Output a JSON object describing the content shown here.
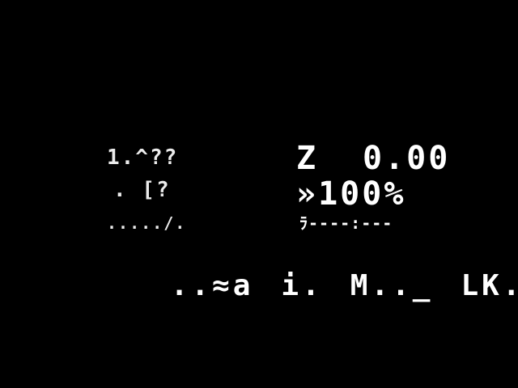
{
  "screen": {
    "background": "#000000",
    "foreground": "#ffffff"
  },
  "left_status": {
    "row1": "1.^??",
    "row2": ". [?",
    "row3": "...../."
  },
  "right_status": {
    "z_label": "Z",
    "z_value": "0.00",
    "speed": "»100%",
    "progress": "ﾗ----:---"
  },
  "bottom_menu": {
    "item1": "..≈a",
    "item2": "i.",
    "item3": "M.._",
    "item4": "LK."
  }
}
